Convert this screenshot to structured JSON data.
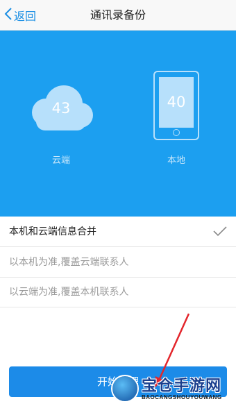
{
  "navbar": {
    "back_label": "返回",
    "title": "通讯录备份"
  },
  "stats": {
    "cloud_count": "43",
    "cloud_label": "云端",
    "local_count": "40",
    "local_label": "本地"
  },
  "options": [
    {
      "label": "本机和云端信息合并",
      "selected": true
    },
    {
      "label": "以本机为准,覆盖云端联系人",
      "selected": false
    },
    {
      "label": "以云端为准,覆盖本机联系人",
      "selected": false
    }
  ],
  "start_button": {
    "label": "开始整理"
  },
  "watermark": {
    "title": "宝仓手游网",
    "subtitle": "BAOCANGSHOUYOUWANG"
  },
  "colors": {
    "accent": "#1c9ff0",
    "button": "#1c8be8",
    "arrow": "#e3262c"
  }
}
